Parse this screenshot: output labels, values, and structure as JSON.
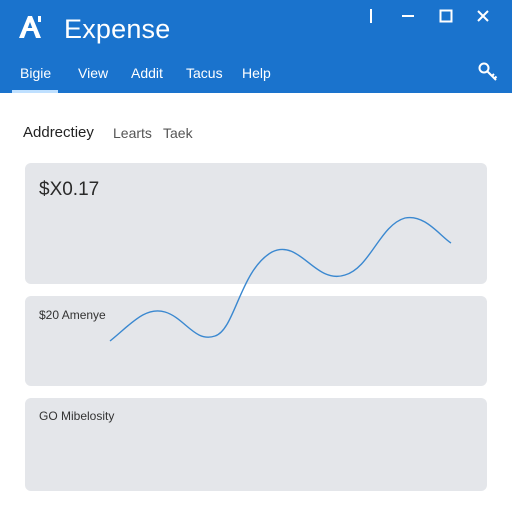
{
  "app": {
    "title": "Expense"
  },
  "menu": {
    "items": [
      "Bigie",
      "View",
      "Addit",
      "Tacus",
      "Help"
    ]
  },
  "tabs": [
    "Addrectiey",
    "Learts",
    "Taek"
  ],
  "cards": [
    {
      "value": "$X0.17"
    },
    {
      "label": "$20 Amenye"
    },
    {
      "label": "GO Mibelosity"
    }
  ],
  "colors": {
    "header": "#1a73cd",
    "card": "#e4e6ea",
    "line": "#3a88d0"
  }
}
